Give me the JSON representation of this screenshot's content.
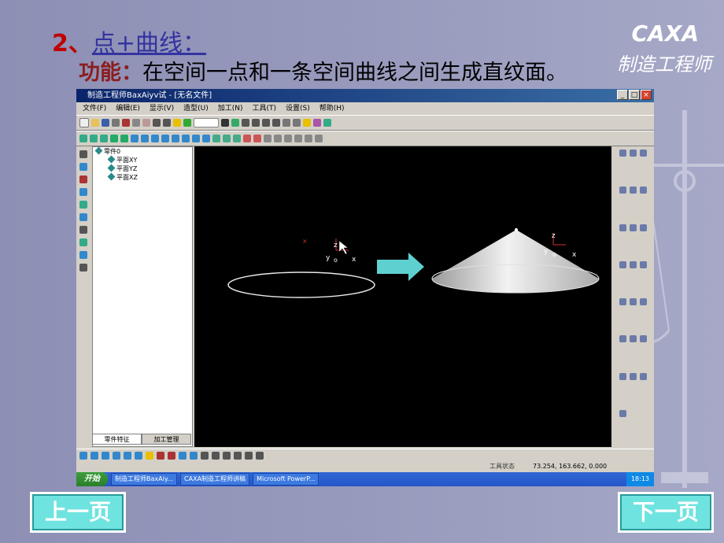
{
  "slide": {
    "title_number": "2、",
    "title_topic": "点+曲线：",
    "brand_en": "CAXA",
    "brand_cn": "制造工程师",
    "function_label": "功能：",
    "function_text": "在空间一点和一条空间曲线之间生成直纹面。",
    "prev_button": "上一页",
    "next_button": "下一页"
  },
  "app": {
    "window_title": "制造工程师BaxAiyv试  - [无名文件]",
    "menu": [
      "文件(F)",
      "编辑(E)",
      "显示(V)",
      "造型(U)",
      "加工(N)",
      "工具(T)",
      "设置(S)",
      "帮助(H)"
    ],
    "tree": {
      "root": "零件0",
      "children": [
        "平面XY",
        "平面YZ",
        "平面XZ"
      ]
    },
    "tabs": [
      "零件特征",
      "加工管理"
    ],
    "status_label": "工具状态",
    "coords": "73.254, 163.662, 0.000",
    "axis_labels": {
      "z": "z",
      "y": "y",
      "x": "x",
      "o": "o"
    }
  },
  "taskbar": {
    "start": "开始",
    "tasks": [
      "制造工程师BaxAiy...",
      "CAXA制造工程师讲稿",
      "Microsoft PowerP..."
    ],
    "clock": "18:13"
  },
  "colors": {
    "background": "#9597bb",
    "title_red": "#c00000",
    "topic_blue": "#3333a0",
    "nav": "#6fe3e0"
  }
}
